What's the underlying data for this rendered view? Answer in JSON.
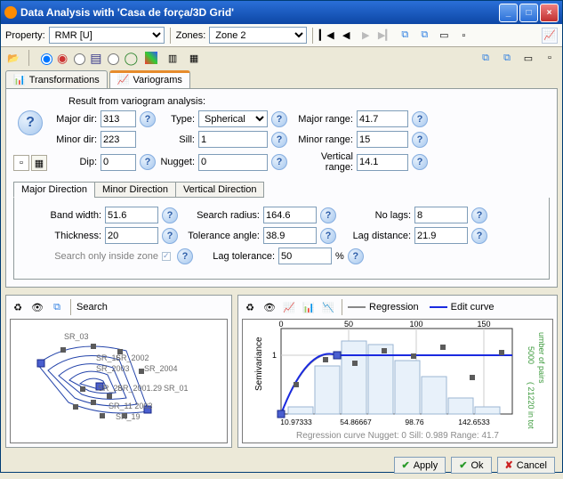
{
  "window": {
    "title": "Data Analysis with 'Casa de força/3D Grid'"
  },
  "topbar": {
    "property_label": "Property:",
    "property_value": "RMR [U]",
    "zones_label": "Zones:",
    "zones_value": "Zone 2"
  },
  "tabs": {
    "transformations": "Transformations",
    "variograms": "Variograms"
  },
  "variogram": {
    "result_label": "Result from variogram analysis:",
    "major_dir_label": "Major dir:",
    "major_dir": "313",
    "type_label": "Type:",
    "type": "Spherical",
    "major_range_label": "Major range:",
    "major_range": "41.7",
    "minor_dir_label": "Minor dir:",
    "minor_dir": "223",
    "sill_label": "Sill:",
    "sill": "1",
    "minor_range_label": "Minor range:",
    "minor_range": "15",
    "dip_label": "Dip:",
    "dip": "0",
    "nugget_label": "Nugget:",
    "nugget": "0",
    "vertical_range_label": "Vertical range:",
    "vertical_range": "14.1"
  },
  "subtabs": {
    "major": "Major Direction",
    "minor": "Minor Direction",
    "vertical": "Vertical Direction"
  },
  "direction": {
    "band_width_label": "Band width:",
    "band_width": "51.6",
    "search_radius_label": "Search radius:",
    "search_radius": "164.6",
    "no_lags_label": "No lags:",
    "no_lags": "8",
    "thickness_label": "Thickness:",
    "thickness": "20",
    "tolerance_label": "Tolerance angle:",
    "tolerance": "38.9",
    "lag_distance_label": "Lag distance:",
    "lag_distance": "21.9",
    "search_zone_label": "Search only inside zone",
    "lag_tolerance_label": "Lag tolerance:",
    "lag_tolerance": "50",
    "lag_tolerance_unit": "%"
  },
  "pane_left": {
    "search": "Search"
  },
  "pane_right": {
    "regression": "Regression",
    "edit_curve": "Edit curve",
    "ylabel": "Semivariance",
    "ylabel2": "Number of pairs",
    "footer": "Regression curve  Nugget: 0  Sill: 0.989  Range: 41.7"
  },
  "chart_data": {
    "type": "variogram-map",
    "left_labels": [
      "SR_03",
      "SR_16",
      "SR_2002",
      "SR_2003",
      "SR_2004",
      "SR_28",
      "SR_29",
      "SR_2001",
      "SR_01",
      "SR_11",
      "SR_2003",
      "SR_19"
    ],
    "right": {
      "type": "variogram",
      "x_ticks": [
        0,
        50,
        100,
        150
      ],
      "x_minor": [
        10.97333,
        54.86667,
        98.76,
        142.6533
      ],
      "y_ticks": [
        "",
        "1"
      ],
      "y2_ticks": [
        "5000",
        "( 21220 in tot"
      ],
      "points": [
        {
          "x": 11,
          "y": 0.45
        },
        {
          "x": 33,
          "y": 0.92
        },
        {
          "x": 55,
          "y": 0.86
        },
        {
          "x": 77,
          "y": 1.04
        },
        {
          "x": 99,
          "y": 1.0
        },
        {
          "x": 121,
          "y": 1.1
        },
        {
          "x": 143,
          "y": 0.72
        },
        {
          "x": 165,
          "y": 1.06
        }
      ],
      "curve_range": 41.7,
      "curve_sill": 0.989,
      "curve_nugget": 0,
      "bars": [
        {
          "x": 11,
          "h": 0.1
        },
        {
          "x": 33,
          "h": 0.62
        },
        {
          "x": 55,
          "h": 0.95
        },
        {
          "x": 77,
          "h": 0.9
        },
        {
          "x": 99,
          "h": 0.66
        },
        {
          "x": 121,
          "h": 0.45
        },
        {
          "x": 143,
          "h": 0.22
        },
        {
          "x": 165,
          "h": 0.1
        }
      ]
    }
  },
  "buttons": {
    "apply": "Apply",
    "ok": "Ok",
    "cancel": "Cancel"
  }
}
